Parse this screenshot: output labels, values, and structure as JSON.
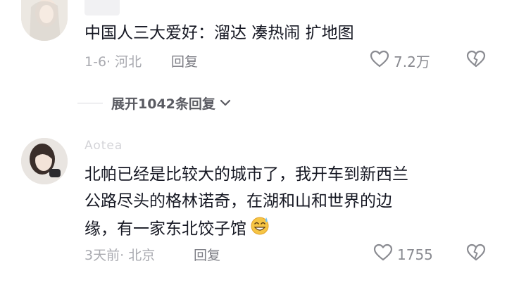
{
  "comments": [
    {
      "text": "中国人三大爱好：溜达 凑热闹 扩地图",
      "date": "1-6",
      "location": "河北",
      "reply_label": "回复",
      "likes": "7.2万"
    },
    {
      "username": "Aotea",
      "text_lines": [
        "北帕已经是比较大的城市了，我开车到新西兰",
        "公路尽头的格林诺奇，在湖和山和世界的边",
        "缘，有一家东北饺子馆"
      ],
      "emoji": "sweat-smile-emoji",
      "date": "3天前",
      "location": "北京",
      "reply_label": "回复",
      "likes": "1755"
    }
  ],
  "expand_replies": {
    "label": "展开1042条回复"
  },
  "icons": {
    "like": "heart-outline-icon",
    "dislike": "broken-heart-icon",
    "expand": "chevron-down-icon"
  },
  "colors": {
    "text": "#161823",
    "meta": "#a9aab0",
    "icon": "#8a8b91"
  }
}
